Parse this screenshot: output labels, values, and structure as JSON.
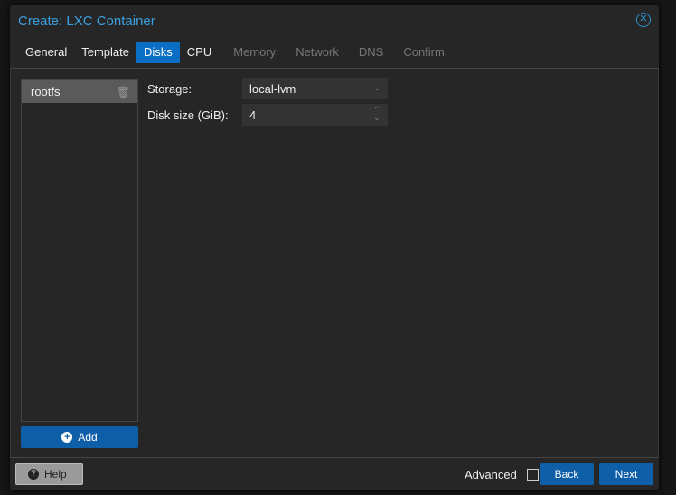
{
  "window": {
    "title": "Create: LXC Container"
  },
  "tabs": [
    {
      "label": "General"
    },
    {
      "label": "Template"
    },
    {
      "label": "Disks"
    },
    {
      "label": "CPU"
    },
    {
      "label": "Memory"
    },
    {
      "label": "Network"
    },
    {
      "label": "DNS"
    },
    {
      "label": "Confirm"
    }
  ],
  "disks": {
    "items": [
      {
        "label": "rootfs"
      }
    ],
    "add_label": "Add"
  },
  "form": {
    "storage_label": "Storage:",
    "storage_value": "local-lvm",
    "size_label": "Disk size (GiB):",
    "size_value": "4"
  },
  "footer": {
    "help": "Help",
    "advanced": "Advanced",
    "back": "Back",
    "next": "Next"
  }
}
